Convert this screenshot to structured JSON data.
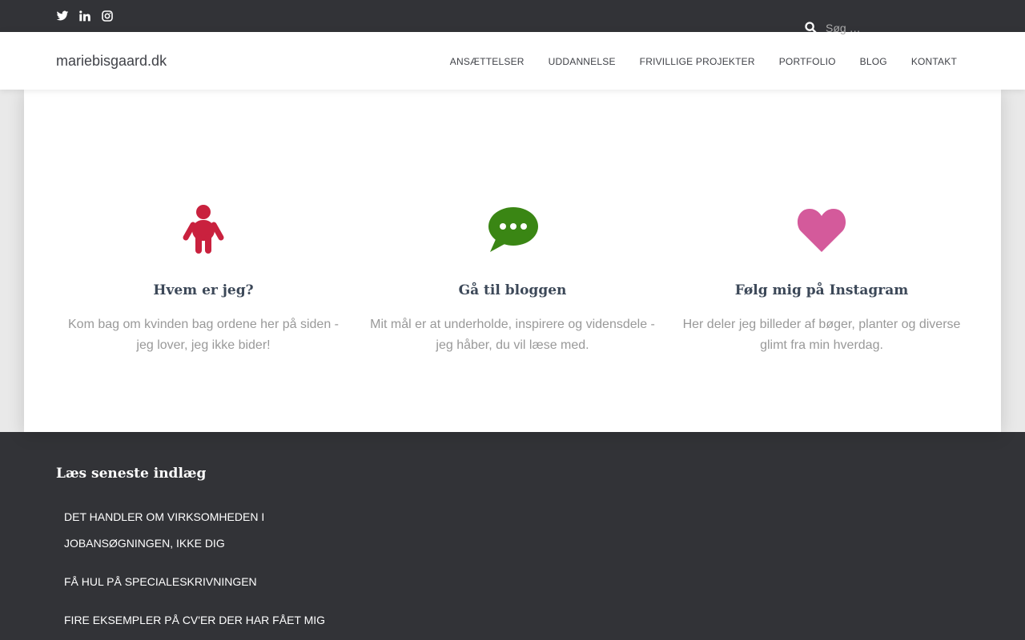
{
  "header": {
    "social": [
      {
        "icon": "twitter-icon"
      },
      {
        "icon": "linkedin-icon"
      },
      {
        "icon": "instagram-icon"
      }
    ],
    "search": {
      "placeholder": "Søg …"
    }
  },
  "nav": {
    "brand": "mariebisgaard.dk",
    "items": [
      "ANSÆTTELSER",
      "UDDANNELSE",
      "FRIVILLIGE PROJEKTER",
      "PORTFOLIO",
      "BLOG",
      "KONTAKT"
    ]
  },
  "features": [
    {
      "icon": "child-icon",
      "color": "#c9213e",
      "title": "Hvem er jeg?",
      "text": "Kom bag om kvinden bag ordene her på siden - jeg lover, jeg ikke bider!"
    },
    {
      "icon": "comment-dots-icon",
      "color": "#3a8614",
      "title": "Gå til bloggen",
      "text": "Mit mål er at underholde, inspirere og vidensdele - jeg håber, du vil læse med."
    },
    {
      "icon": "heart-icon",
      "color": "#d45a9b",
      "title": "Følg mig på Instagram",
      "text": "Her deler jeg billeder af bøger, planter og diverse glimt fra min hverdag."
    }
  ],
  "footer": {
    "title": "Læs seneste indlæg",
    "posts": [
      "Det handler om virksomheden i jobansøgningen, ikke dig",
      "Få hul på specialeskrivningen",
      "Fire eksempler på CV'er der har fået mig"
    ]
  },
  "colors": {
    "dark": "#323337",
    "text": "#404248",
    "muted": "#999999"
  }
}
